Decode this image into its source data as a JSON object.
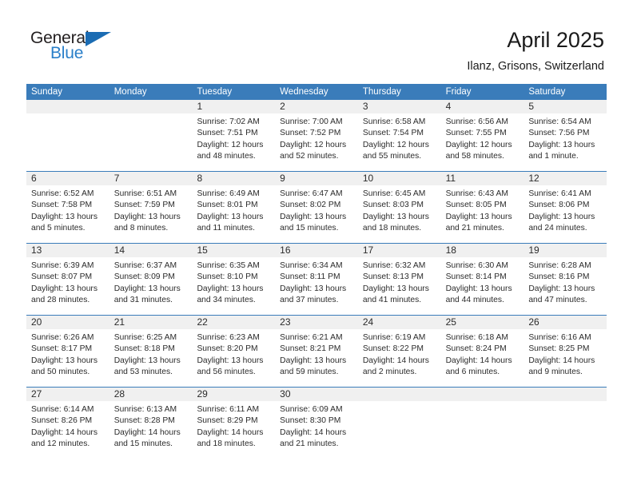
{
  "brand": {
    "name_part1": "General",
    "name_part2": "Blue",
    "triangle_icon": "triangle-icon",
    "colors": {
      "black": "#231f20",
      "blue": "#2a7fc9",
      "triangle": "#1b6cb3"
    }
  },
  "header": {
    "title": "April 2025",
    "subtitle": "Ilanz, Grisons, Switzerland"
  },
  "theme": {
    "header_blue": "#3a7cba",
    "strip_gray": "#f0f0f0",
    "text": "#2b2b2b"
  },
  "calendar": {
    "weekday_headers": [
      "Sunday",
      "Monday",
      "Tuesday",
      "Wednesday",
      "Thursday",
      "Friday",
      "Saturday"
    ],
    "weeks": [
      [
        {
          "day": "",
          "sunrise": "",
          "sunset": "",
          "daylight_1": "",
          "daylight_2": "",
          "empty": true
        },
        {
          "day": "",
          "sunrise": "",
          "sunset": "",
          "daylight_1": "",
          "daylight_2": "",
          "empty": true
        },
        {
          "day": "1",
          "sunrise": "Sunrise: 7:02 AM",
          "sunset": "Sunset: 7:51 PM",
          "daylight_1": "Daylight: 12 hours",
          "daylight_2": "and 48 minutes."
        },
        {
          "day": "2",
          "sunrise": "Sunrise: 7:00 AM",
          "sunset": "Sunset: 7:52 PM",
          "daylight_1": "Daylight: 12 hours",
          "daylight_2": "and 52 minutes."
        },
        {
          "day": "3",
          "sunrise": "Sunrise: 6:58 AM",
          "sunset": "Sunset: 7:54 PM",
          "daylight_1": "Daylight: 12 hours",
          "daylight_2": "and 55 minutes."
        },
        {
          "day": "4",
          "sunrise": "Sunrise: 6:56 AM",
          "sunset": "Sunset: 7:55 PM",
          "daylight_1": "Daylight: 12 hours",
          "daylight_2": "and 58 minutes."
        },
        {
          "day": "5",
          "sunrise": "Sunrise: 6:54 AM",
          "sunset": "Sunset: 7:56 PM",
          "daylight_1": "Daylight: 13 hours",
          "daylight_2": "and 1 minute."
        }
      ],
      [
        {
          "day": "6",
          "sunrise": "Sunrise: 6:52 AM",
          "sunset": "Sunset: 7:58 PM",
          "daylight_1": "Daylight: 13 hours",
          "daylight_2": "and 5 minutes."
        },
        {
          "day": "7",
          "sunrise": "Sunrise: 6:51 AM",
          "sunset": "Sunset: 7:59 PM",
          "daylight_1": "Daylight: 13 hours",
          "daylight_2": "and 8 minutes."
        },
        {
          "day": "8",
          "sunrise": "Sunrise: 6:49 AM",
          "sunset": "Sunset: 8:01 PM",
          "daylight_1": "Daylight: 13 hours",
          "daylight_2": "and 11 minutes."
        },
        {
          "day": "9",
          "sunrise": "Sunrise: 6:47 AM",
          "sunset": "Sunset: 8:02 PM",
          "daylight_1": "Daylight: 13 hours",
          "daylight_2": "and 15 minutes."
        },
        {
          "day": "10",
          "sunrise": "Sunrise: 6:45 AM",
          "sunset": "Sunset: 8:03 PM",
          "daylight_1": "Daylight: 13 hours",
          "daylight_2": "and 18 minutes."
        },
        {
          "day": "11",
          "sunrise": "Sunrise: 6:43 AM",
          "sunset": "Sunset: 8:05 PM",
          "daylight_1": "Daylight: 13 hours",
          "daylight_2": "and 21 minutes."
        },
        {
          "day": "12",
          "sunrise": "Sunrise: 6:41 AM",
          "sunset": "Sunset: 8:06 PM",
          "daylight_1": "Daylight: 13 hours",
          "daylight_2": "and 24 minutes."
        }
      ],
      [
        {
          "day": "13",
          "sunrise": "Sunrise: 6:39 AM",
          "sunset": "Sunset: 8:07 PM",
          "daylight_1": "Daylight: 13 hours",
          "daylight_2": "and 28 minutes."
        },
        {
          "day": "14",
          "sunrise": "Sunrise: 6:37 AM",
          "sunset": "Sunset: 8:09 PM",
          "daylight_1": "Daylight: 13 hours",
          "daylight_2": "and 31 minutes."
        },
        {
          "day": "15",
          "sunrise": "Sunrise: 6:35 AM",
          "sunset": "Sunset: 8:10 PM",
          "daylight_1": "Daylight: 13 hours",
          "daylight_2": "and 34 minutes."
        },
        {
          "day": "16",
          "sunrise": "Sunrise: 6:34 AM",
          "sunset": "Sunset: 8:11 PM",
          "daylight_1": "Daylight: 13 hours",
          "daylight_2": "and 37 minutes."
        },
        {
          "day": "17",
          "sunrise": "Sunrise: 6:32 AM",
          "sunset": "Sunset: 8:13 PM",
          "daylight_1": "Daylight: 13 hours",
          "daylight_2": "and 41 minutes."
        },
        {
          "day": "18",
          "sunrise": "Sunrise: 6:30 AM",
          "sunset": "Sunset: 8:14 PM",
          "daylight_1": "Daylight: 13 hours",
          "daylight_2": "and 44 minutes."
        },
        {
          "day": "19",
          "sunrise": "Sunrise: 6:28 AM",
          "sunset": "Sunset: 8:16 PM",
          "daylight_1": "Daylight: 13 hours",
          "daylight_2": "and 47 minutes."
        }
      ],
      [
        {
          "day": "20",
          "sunrise": "Sunrise: 6:26 AM",
          "sunset": "Sunset: 8:17 PM",
          "daylight_1": "Daylight: 13 hours",
          "daylight_2": "and 50 minutes."
        },
        {
          "day": "21",
          "sunrise": "Sunrise: 6:25 AM",
          "sunset": "Sunset: 8:18 PM",
          "daylight_1": "Daylight: 13 hours",
          "daylight_2": "and 53 minutes."
        },
        {
          "day": "22",
          "sunrise": "Sunrise: 6:23 AM",
          "sunset": "Sunset: 8:20 PM",
          "daylight_1": "Daylight: 13 hours",
          "daylight_2": "and 56 minutes."
        },
        {
          "day": "23",
          "sunrise": "Sunrise: 6:21 AM",
          "sunset": "Sunset: 8:21 PM",
          "daylight_1": "Daylight: 13 hours",
          "daylight_2": "and 59 minutes."
        },
        {
          "day": "24",
          "sunrise": "Sunrise: 6:19 AM",
          "sunset": "Sunset: 8:22 PM",
          "daylight_1": "Daylight: 14 hours",
          "daylight_2": "and 2 minutes."
        },
        {
          "day": "25",
          "sunrise": "Sunrise: 6:18 AM",
          "sunset": "Sunset: 8:24 PM",
          "daylight_1": "Daylight: 14 hours",
          "daylight_2": "and 6 minutes."
        },
        {
          "day": "26",
          "sunrise": "Sunrise: 6:16 AM",
          "sunset": "Sunset: 8:25 PM",
          "daylight_1": "Daylight: 14 hours",
          "daylight_2": "and 9 minutes."
        }
      ],
      [
        {
          "day": "27",
          "sunrise": "Sunrise: 6:14 AM",
          "sunset": "Sunset: 8:26 PM",
          "daylight_1": "Daylight: 14 hours",
          "daylight_2": "and 12 minutes."
        },
        {
          "day": "28",
          "sunrise": "Sunrise: 6:13 AM",
          "sunset": "Sunset: 8:28 PM",
          "daylight_1": "Daylight: 14 hours",
          "daylight_2": "and 15 minutes."
        },
        {
          "day": "29",
          "sunrise": "Sunrise: 6:11 AM",
          "sunset": "Sunset: 8:29 PM",
          "daylight_1": "Daylight: 14 hours",
          "daylight_2": "and 18 minutes."
        },
        {
          "day": "30",
          "sunrise": "Sunrise: 6:09 AM",
          "sunset": "Sunset: 8:30 PM",
          "daylight_1": "Daylight: 14 hours",
          "daylight_2": "and 21 minutes."
        },
        {
          "day": "",
          "sunrise": "",
          "sunset": "",
          "daylight_1": "",
          "daylight_2": "",
          "empty": true
        },
        {
          "day": "",
          "sunrise": "",
          "sunset": "",
          "daylight_1": "",
          "daylight_2": "",
          "empty": true
        },
        {
          "day": "",
          "sunrise": "",
          "sunset": "",
          "daylight_1": "",
          "daylight_2": "",
          "empty": true
        }
      ]
    ]
  }
}
